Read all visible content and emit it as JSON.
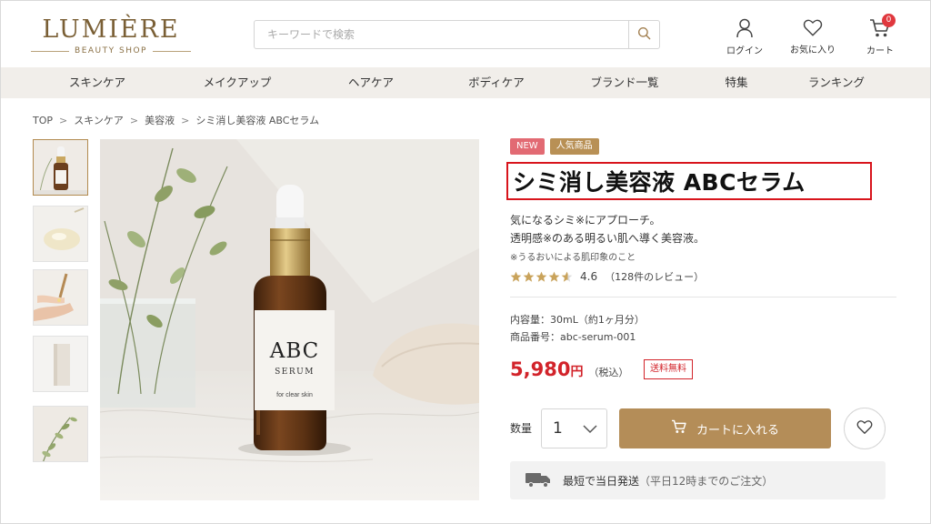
{
  "header": {
    "logo_main": "LUMIÈRE",
    "logo_sub": "BEAUTY SHOP",
    "search_placeholder": "キーワードで検索",
    "login_label": "ログイン",
    "favorites_label": "お気に入り",
    "cart_label": "カート",
    "cart_count": "0"
  },
  "nav": {
    "items": [
      {
        "label": "スキンケア"
      },
      {
        "label": "メイクアップ"
      },
      {
        "label": "ヘアケア"
      },
      {
        "label": "ボディケア"
      },
      {
        "label": "ブランド一覧"
      },
      {
        "label": "特集"
      },
      {
        "label": "ランキング"
      }
    ]
  },
  "breadcrumb": {
    "items": [
      "TOP",
      "スキンケア",
      "美容液",
      "シミ消し美容液 ABCセラム"
    ],
    "separator": ">"
  },
  "gallery": {
    "thumb_count": 5,
    "bottle_label": "ABC",
    "bottle_sub": "SERUM",
    "bottle_caption": "for clear skin"
  },
  "product": {
    "badge_new": "NEW",
    "badge_popular": "人気商品",
    "title": "シミ消し美容液 ABCセラム",
    "desc_line1": "気になるシミ※にアプローチ。",
    "desc_line2": "透明感※のある明るい肌へ導く美容液。",
    "note": "※うるおいによる肌印象のこと",
    "rating_value": 4.6,
    "rating_text": "4.6",
    "review_text": "（128件のレビュー）",
    "volume": "内容量：30mL（約1ヶ月分）",
    "sku": "商品番号：abc-serum-001",
    "price": "5,980",
    "currency": "円",
    "tax_note": "（税込）",
    "shipping_badge": "送料無料",
    "qty_label": "数量",
    "qty_value": "1",
    "cart_button": "カートに入れる",
    "shipping_main": "最短で当日発送",
    "shipping_sub": "（平日12時までのご注文）"
  },
  "colors": {
    "brand_gold": "#b48d58",
    "price_red": "#d2232a",
    "highlight_border": "#d8141c",
    "nav_bg": "#f1eeea"
  }
}
